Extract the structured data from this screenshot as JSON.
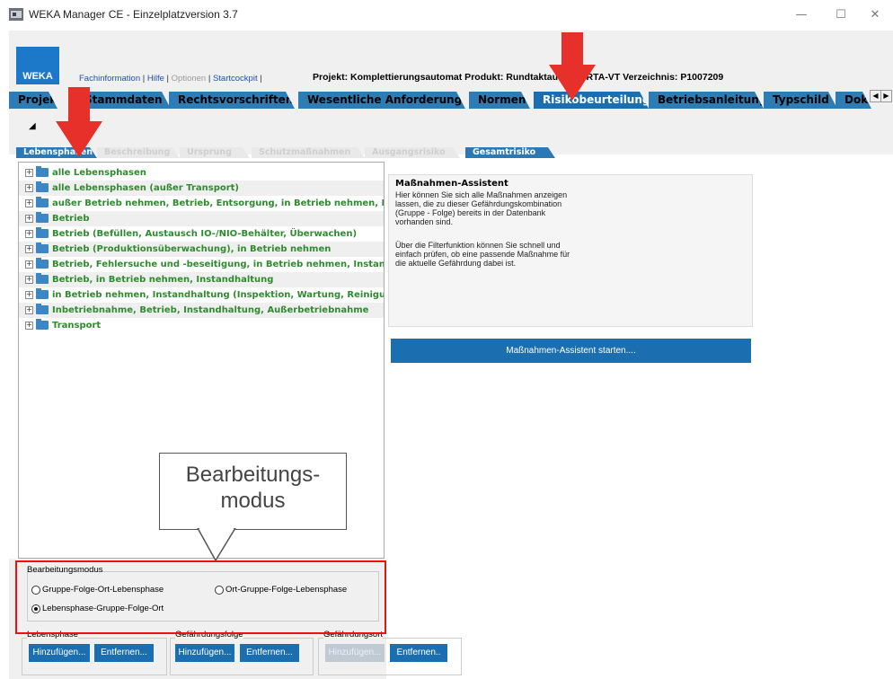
{
  "window": {
    "title": "WEKA Manager CE - Einzelplatzversion 3.7",
    "minimize": "—",
    "maximize": "☐",
    "close": "✕"
  },
  "header": {
    "logo": "WEKA",
    "links": [
      "Fachinformation",
      "Hilfe",
      "Optionen",
      "Startcockpit"
    ],
    "link_sep": "|",
    "project_info": "Projekt: Komplettierungsautomat   Produkt: Rundtaktautomat RTA-VT   Verzeichnis: P1007209"
  },
  "main_tabs": [
    "Projekt",
    "Stammdaten",
    "Rechtsvorschriften",
    "Wesentliche Anforderungen",
    "Normen",
    "Risikobeurteilung",
    "Betriebsanleitung",
    "Typschild",
    "Dok"
  ],
  "main_tab_active": "Risikobeurteilung",
  "tab_scroll": {
    "left": "◀",
    "right": "▶"
  },
  "sub_tabs": [
    "Lebensphasen",
    "Beschreibung",
    "Ursprung",
    "Schutzmaßnahmen",
    "Ausgangsrisiko",
    "Gesamtrisiko"
  ],
  "sub_tab_active": "Lebensphasen",
  "tree": {
    "expander": "+",
    "items": [
      "alle Lebensphasen",
      "alle Lebensphasen (außer Transport)",
      "außer Betrieb nehmen, Betrieb, Entsorgung, in Betrieb nehmen, Instandhaltung",
      "Betrieb",
      "Betrieb (Befüllen, Austausch IO-/NIO-Behälter, Überwachen)",
      "Betrieb (Produktionsüberwachung), in Betrieb nehmen",
      "Betrieb, Fehlersuche und -beseitigung, in Betrieb nehmen, Instandhaltung",
      "Betrieb, in Betrieb nehmen, Instandhaltung",
      "in Betrieb nehmen, Instandhaltung (Inspektion, Wartung, Reinigung, Reparatur)",
      "Inbetriebnahme, Betrieb, Instandhaltung, Außerbetriebnahme",
      "Transport"
    ]
  },
  "assistant": {
    "title": "Maßnahmen-Assistent",
    "p1": "Hier können Sie sich alle Maßnahmen anzeigen lassen, die zu dieser Gefährdungskombination (Gruppe - Folge) bereits in der Datenbank vorhanden sind.",
    "p2": "Über die Filterfunktion können Sie schnell und einfach prüfen, ob eine passende Maßnahme für die aktuelle Gefährdung dabei ist.",
    "button": "Maßnahmen-Assistent starten...."
  },
  "callout": {
    "line1": "Bearbeitungs-",
    "line2": "modus"
  },
  "mode": {
    "label": "Bearbeitungsmodus",
    "options": [
      "Gruppe-Folge-Ort-Lebensphase",
      "Ort-Gruppe-Folge-Lebensphase",
      "Lebensphase-Gruppe-Folge-Ort"
    ],
    "selected": "Lebensphase-Gruppe-Folge-Ort"
  },
  "groups": [
    {
      "label": "Lebensphase",
      "add": "Hinzufügen...",
      "remove": "Entfernen..."
    },
    {
      "label": "Gefährdungsfolge",
      "add": "Hinzufügen...",
      "remove": "Entfernen..."
    },
    {
      "label": "Gefährdungsort",
      "add": "Hinzufügen...",
      "remove": "Entfernen.."
    }
  ],
  "colors": {
    "accent": "#1b6fb1",
    "tree_text": "#2e8b2e",
    "highlight": "#e11111",
    "arrow": "#e8302a"
  }
}
